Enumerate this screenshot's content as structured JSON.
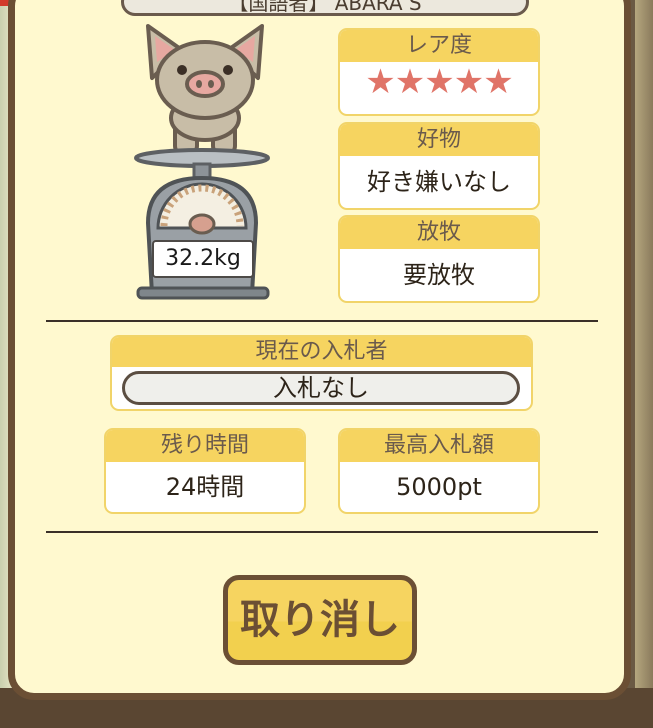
{
  "header": {
    "title": "【国語者】 ABARA S"
  },
  "pig": {
    "weight": "32.2kg"
  },
  "rarity": {
    "label": "レア度",
    "stars": "★★★★★",
    "count": 5
  },
  "favorite": {
    "label": "好物",
    "value": "好き嫌いなし"
  },
  "grazing": {
    "label": "放牧",
    "value": "要放牧"
  },
  "bidder": {
    "label": "現在の入札者",
    "value": "入札なし"
  },
  "remaining": {
    "label": "残り時間",
    "value": "24時間"
  },
  "highest_bid": {
    "label": "最高入札額",
    "value": "5000pt"
  },
  "actions": {
    "cancel_label": "取り消し"
  },
  "colors": {
    "panel_bg": "#fff9cf",
    "frame": "#6b4f34",
    "card_header": "#f6d460",
    "star": "#e07468"
  }
}
